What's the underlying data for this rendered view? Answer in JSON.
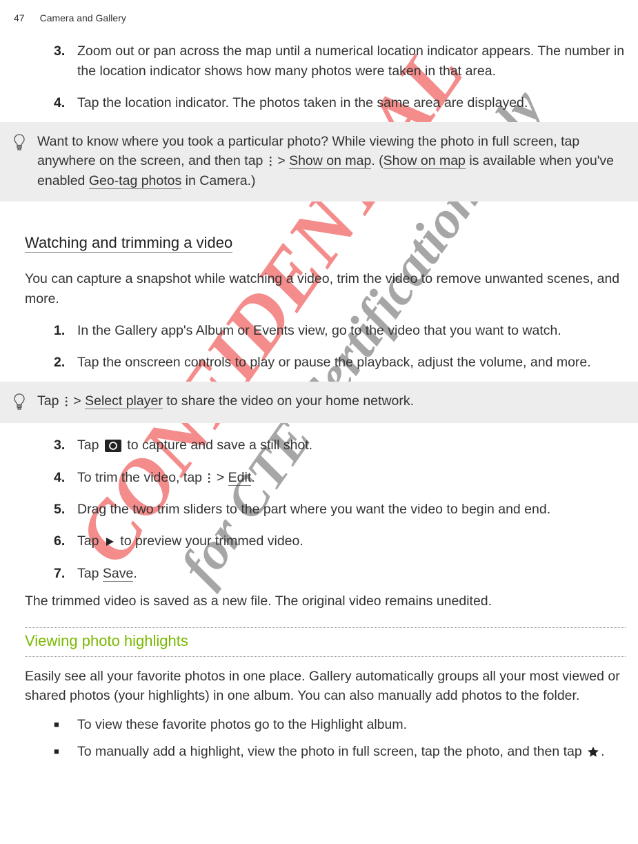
{
  "header": {
    "page": "47",
    "chapter": "Camera and Gallery"
  },
  "watermark1": "CONFIDENTIAL",
  "watermark2": "for CTE Certification only",
  "steps_a": {
    "3": "Zoom out or pan across the map until a numerical location indicator appears. The number in the location indicator shows how many photos were taken in that area.",
    "4": "Tap the location indicator. The photos taken in the same area are displayed."
  },
  "tip1": {
    "pre": "Want to know where you took a particular photo? While viewing the photo in full screen, tap anywhere on the screen, and then tap ",
    "mid1": " > ",
    "b1": "Show on map",
    "mid2": ". (",
    "b2": "Show on map",
    "mid3": " is available when you've enabled ",
    "b3": "Geo-tag photos",
    "post": " in Camera.)"
  },
  "section_watch": {
    "title": "Watching and trimming a video",
    "intro": "You can capture a snapshot while watching a video, trim the video to remove unwanted scenes, and more.",
    "steps": {
      "1": "In the Gallery app's Album or Events view, go to the video that you want to watch.",
      "2": "Tap the onscreen controls to play or pause the playback, adjust the volume, and more."
    }
  },
  "tip2": {
    "pre": "Tap ",
    "mid1": " > ",
    "b1": "Select player",
    "post": " to share the video on your home network."
  },
  "steps_b": {
    "3": {
      "pre": "Tap ",
      "post": " to capture and save a still shot."
    },
    "4": {
      "pre": "To trim the video, tap ",
      "mid": " > ",
      "b": "Edit",
      "post": "."
    },
    "5": "Drag the two trim sliders to the part where you want the video to begin and end.",
    "6": {
      "pre": "Tap ",
      "post": " to preview your trimmed video."
    },
    "7": {
      "pre": "Tap ",
      "b": "Save",
      "post": "."
    }
  },
  "closing": "The trimmed video is saved as a new file. The original video remains unedited.",
  "section_highlights": {
    "title": "Viewing photo highlights",
    "intro": "Easily see all your favorite photos in one place. Gallery automatically groups all your most viewed or shared photos (your highlights) in one album. You can also manually add photos to the folder.",
    "ul": {
      "1": "To view these favorite photos go to the Highlight album.",
      "2": {
        "pre": "To manually add a highlight, view the photo in full screen, tap the photo, and then tap ",
        "post": "."
      }
    }
  }
}
